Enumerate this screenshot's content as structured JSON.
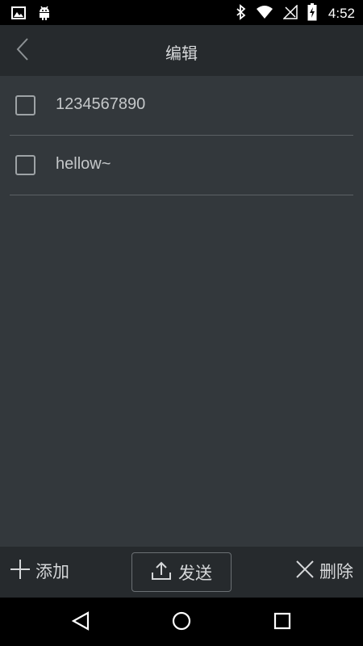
{
  "status_bar": {
    "time": "4:52",
    "icons": [
      "image-icon",
      "android-icon",
      "bluetooth-icon",
      "wifi-icon",
      "no-signal-icon",
      "battery-charging-icon"
    ]
  },
  "app_bar": {
    "title": "编辑",
    "back_icon": "chevron-left-icon"
  },
  "list": {
    "items": [
      {
        "label": "1234567890",
        "checked": false
      },
      {
        "label": "hellow~",
        "checked": false
      }
    ]
  },
  "toolbar": {
    "add_label": "添加",
    "send_label": "发送",
    "delete_label": "删除"
  },
  "nav_bar": {
    "buttons": [
      "back-triangle-icon",
      "home-circle-icon",
      "recents-square-icon"
    ]
  },
  "colors": {
    "app_bar_bg": "#262a2d",
    "content_bg": "#33383c",
    "text": "#d6d8da",
    "divider": "#5b6064"
  }
}
